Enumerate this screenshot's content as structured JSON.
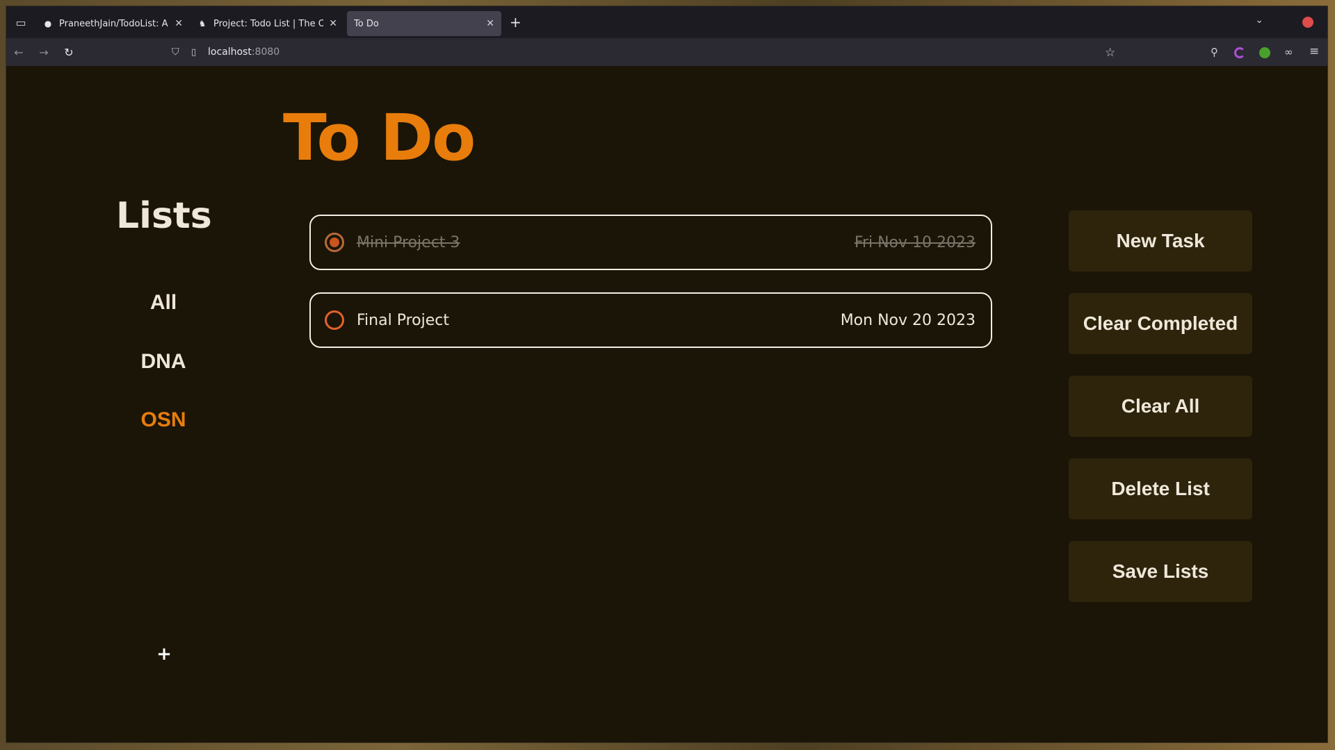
{
  "browser": {
    "tabs": [
      {
        "title": "PraneethJain/TodoList: A Si",
        "icon": "github-icon",
        "active": false
      },
      {
        "title": "Project: Todo List | The Odin",
        "icon": "odin-icon",
        "active": false
      },
      {
        "title": "To Do",
        "icon": "",
        "active": true
      }
    ],
    "url_host": "localhost",
    "url_port": ":8080"
  },
  "app": {
    "title": "To Do",
    "lists_heading": "Lists",
    "lists": [
      {
        "label": "All",
        "active": false
      },
      {
        "label": "DNA",
        "active": false
      },
      {
        "label": "OSN",
        "active": true
      }
    ],
    "add_list_label": "+",
    "tasks": [
      {
        "name": "Mini Project 3",
        "date": "Fri Nov 10 2023",
        "completed": true
      },
      {
        "name": "Final Project",
        "date": "Mon Nov 20 2023",
        "completed": false
      }
    ],
    "actions": {
      "new_task": "New Task",
      "clear_completed": "Clear Completed",
      "clear_all": "Clear All",
      "delete_list": "Delete List",
      "save_lists": "Save Lists"
    }
  },
  "colors": {
    "accent": "#e87d0c",
    "background": "#1b1508",
    "button_bg": "#2e240c"
  }
}
